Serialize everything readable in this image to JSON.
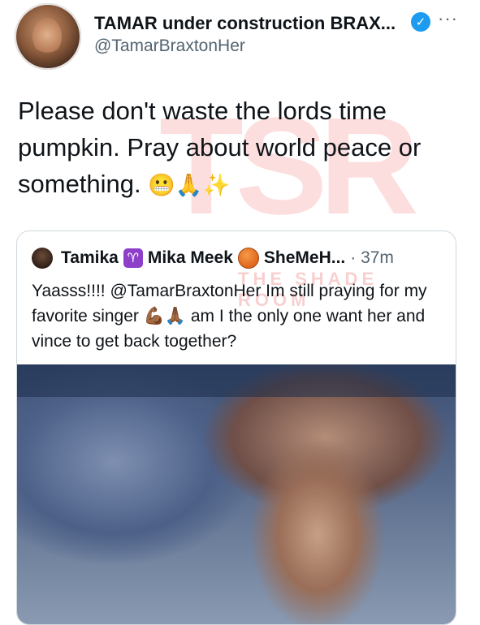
{
  "tweet": {
    "display_name": "TAMAR under construction BRAX...",
    "handle": "@TamarBraxtonHer",
    "more_label": "···",
    "verified_icon": "verified-check-icon",
    "text": "Please don't waste the lords time pumpkin. Pray about world peace or something.",
    "emojis": "😬🙏✨",
    "watermark": "TSR"
  },
  "quoted_tweet": {
    "name_1": "Tamika",
    "name_2": "Mika Meek",
    "name_3": "SheMeH...",
    "time": "· 37m",
    "text": "Yaasss!!!! @TamarBraxtonHer Im still praying for my favorite singer 💪🏾🙏🏾 am I the only one want her and vince to get back together?",
    "watermark": "THE SHADE ROOM"
  },
  "colors": {
    "verified": "#1d9bf0",
    "secondary_text": "#536471",
    "watermark": "#f48a8a"
  }
}
